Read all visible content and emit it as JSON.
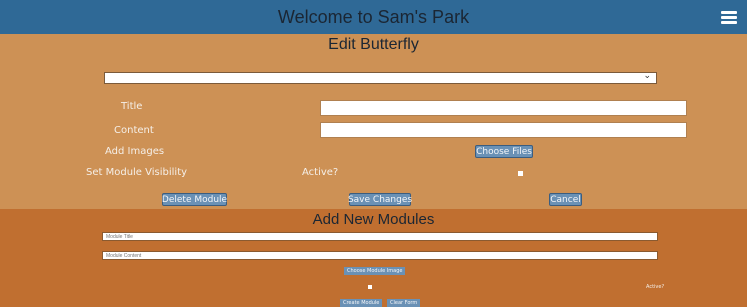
{
  "header": {
    "title": "Welcome to Sam's Park",
    "menu_icon": "hamburger-menu-icon"
  },
  "edit_section": {
    "heading": "Edit Butterfly",
    "module_select": {
      "selected": ""
    },
    "title_label": "Title",
    "title_value": "",
    "content_label": "Content",
    "content_value": "",
    "add_images_label": "Add Images",
    "choose_files_label": "Choose Files",
    "visibility_label": "Set Module Visibility",
    "active_label": "Active?",
    "delete_label": "Delete Module",
    "save_label": "Save Changes",
    "cancel_label": "Cancel"
  },
  "add_section": {
    "heading": "Add New Modules",
    "title_placeholder": "Module Title",
    "content_placeholder": "Module Content",
    "choose_image_label": "Choose Module Image",
    "active_label": "Active?",
    "create_label": "Create Module",
    "clear_label": "Clear Form"
  },
  "colors": {
    "header_bg": "#2f6996",
    "edit_bg": "#cd9155",
    "add_bg": "#c06f30",
    "button_bg": "#6a91b5"
  }
}
